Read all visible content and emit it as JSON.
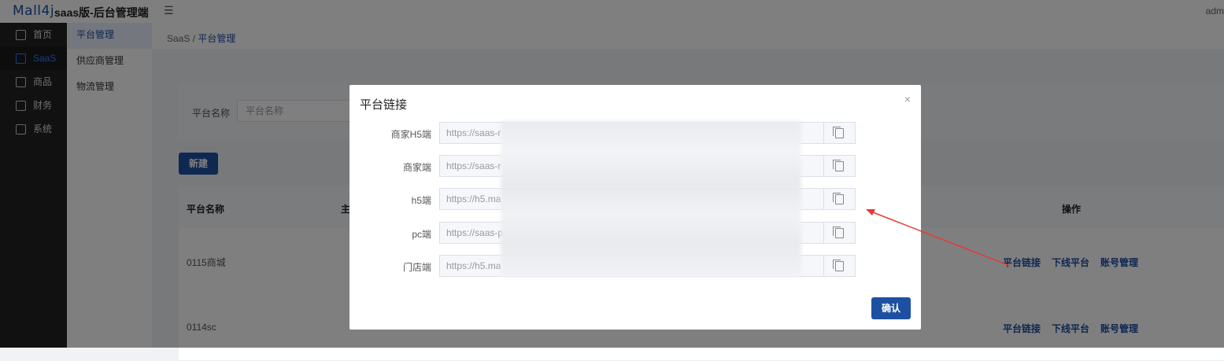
{
  "topbar": {
    "logo": "Mall4j",
    "subtitle": "saas版-后台管理端",
    "fold_icon": "menu-fold-icon",
    "user": "adm"
  },
  "sidebar": {
    "items": [
      {
        "label": "首页",
        "icon": "home-icon"
      },
      {
        "label": "SaaS",
        "icon": "saas-icon"
      },
      {
        "label": "商品",
        "icon": "goods-icon"
      },
      {
        "label": "财务",
        "icon": "finance-icon"
      },
      {
        "label": "系统",
        "icon": "system-icon"
      }
    ]
  },
  "submenu": {
    "items": [
      {
        "label": "平台管理"
      },
      {
        "label": "供应商管理"
      },
      {
        "label": "物流管理"
      }
    ]
  },
  "breadcrumb": {
    "root": "SaaS",
    "sep": "/",
    "current": "平台管理"
  },
  "search": {
    "label": "平台名称",
    "placeholder": "平台名称"
  },
  "new_button": "新建",
  "table": {
    "headers": {
      "name": "平台名称",
      "main": "主",
      "op": "操作"
    },
    "rows": [
      {
        "name": "0115商城",
        "ops": [
          "平台链接",
          "下线平台",
          "账号管理"
        ]
      },
      {
        "name": "0114sc",
        "ops": [
          "平台链接",
          "下线平台",
          "账号管理"
        ]
      }
    ]
  },
  "modal": {
    "title": "平台链接",
    "close": "×",
    "fields": [
      {
        "label": "商家H5端",
        "value": "https://saas-r"
      },
      {
        "label": "商家端",
        "value": "https://saas-r"
      },
      {
        "label": "h5端",
        "value": "https://h5.ma"
      },
      {
        "label": "pc端",
        "value": "https://saas-p"
      },
      {
        "label": "门店端",
        "value": "https://h5.ma"
      }
    ],
    "confirm": "确认",
    "annotation_color": "#e53935"
  }
}
